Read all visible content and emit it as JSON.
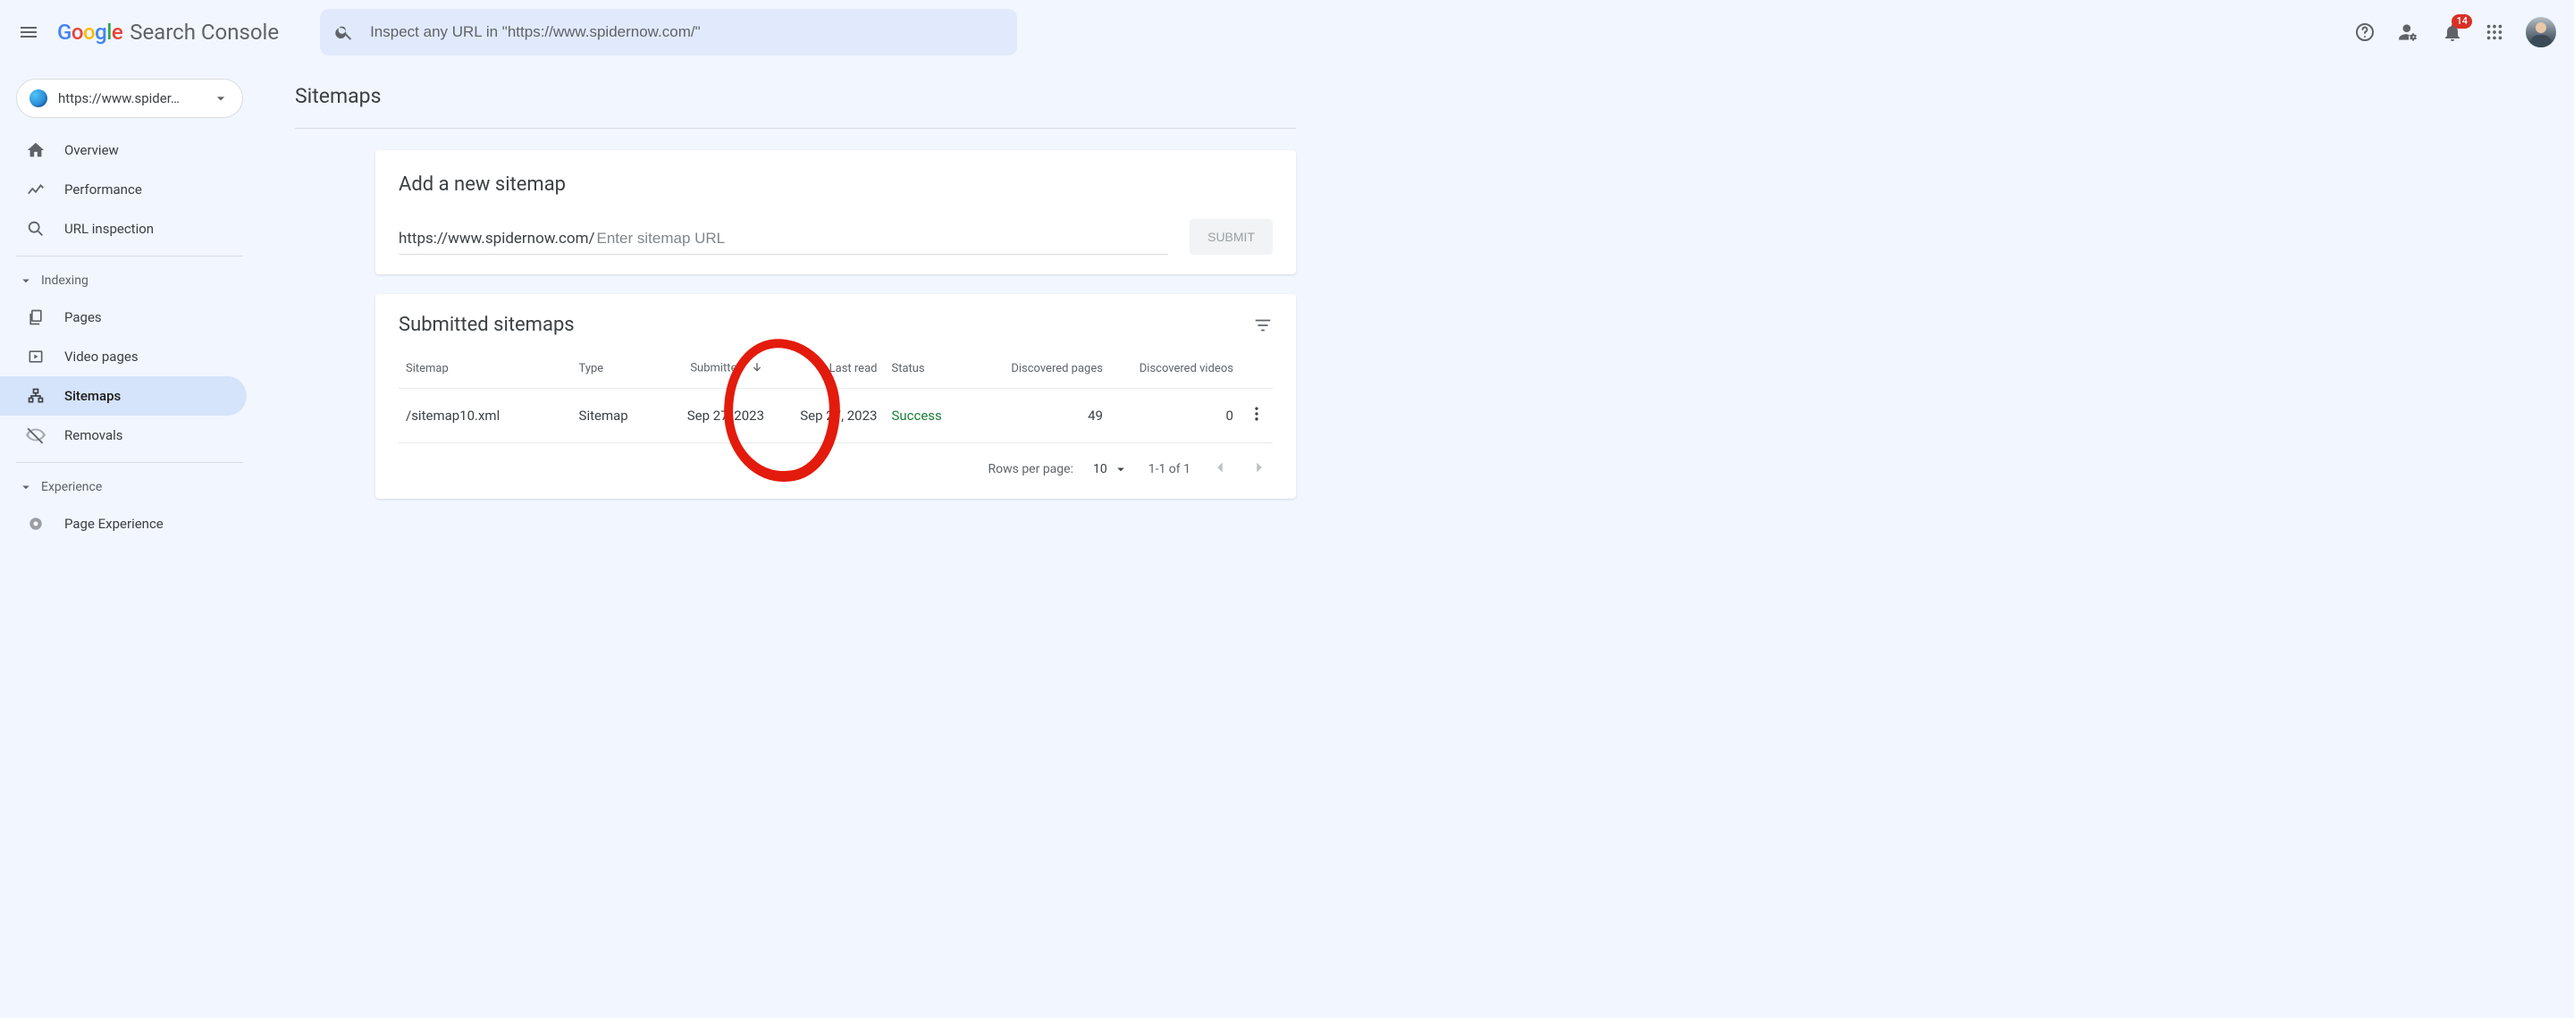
{
  "header": {
    "product": "Search Console",
    "search_placeholder": "Inspect any URL in \"https://www.spidernow.com/\"",
    "notification_count": "14"
  },
  "property": {
    "label": "https://www.spider…"
  },
  "sidebar": {
    "overview": "Overview",
    "performance": "Performance",
    "url_inspection": "URL inspection",
    "group_indexing": "Indexing",
    "pages": "Pages",
    "video_pages": "Video pages",
    "sitemaps": "Sitemaps",
    "removals": "Removals",
    "group_experience": "Experience",
    "page_experience": "Page Experience"
  },
  "page": {
    "title": "Sitemaps"
  },
  "add_card": {
    "title": "Add a new sitemap",
    "url_prefix": "https://www.spidernow.com/ ",
    "placeholder": "Enter sitemap URL",
    "submit": "SUBMIT"
  },
  "table": {
    "title": "Submitted sitemaps",
    "headers": {
      "sitemap": "Sitemap",
      "type": "Type",
      "submitted": "Submitted",
      "last_read": "Last read",
      "status": "Status",
      "disc_pages": "Discovered pages",
      "disc_videos": "Discovered videos"
    },
    "rows": [
      {
        "sitemap": "/sitemap10.xml",
        "type": "Sitemap",
        "submitted": "Sep 27, 2023",
        "last_read": "Sep 27, 2023",
        "status": "Success",
        "disc_pages": "49",
        "disc_videos": "0"
      }
    ],
    "pager": {
      "rpp_label": "Rows per page:",
      "rpp_value": "10",
      "range": "1-1 of 1"
    }
  }
}
